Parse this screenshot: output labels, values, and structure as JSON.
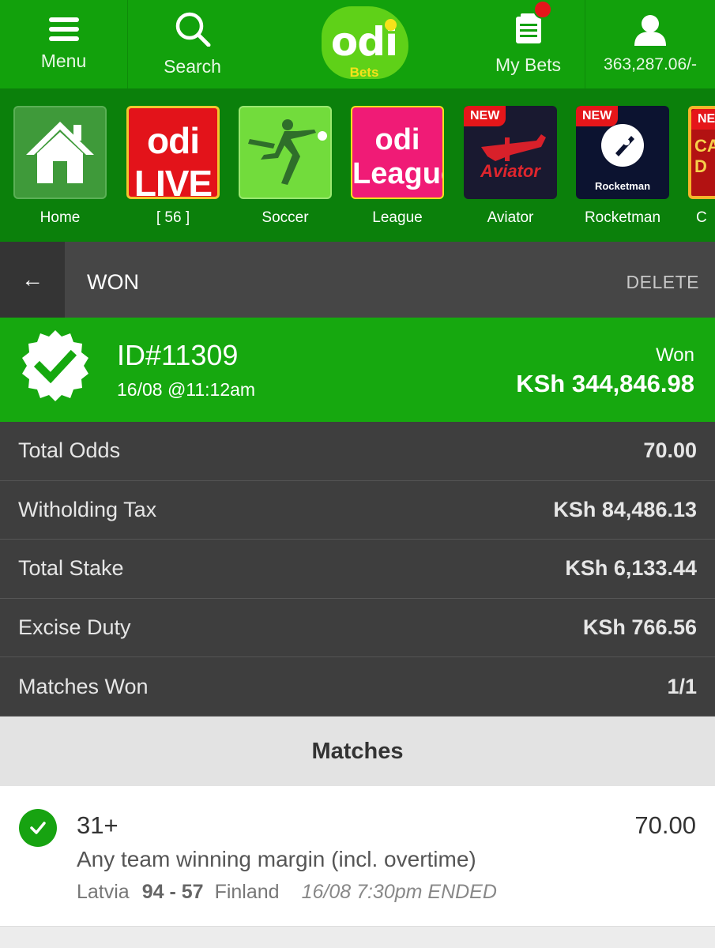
{
  "nav": {
    "menu_label": "Menu",
    "search_label": "Search",
    "logo_text": "odi",
    "logo_sub": "Bets",
    "mybets_label": "My Bets",
    "balance": "363,287.06/-"
  },
  "games": [
    {
      "label": "Home",
      "tile_text": "",
      "badge": ""
    },
    {
      "label": "[ 56 ]",
      "tile_text": "odi LIVE",
      "badge": ""
    },
    {
      "label": "Soccer",
      "tile_text": "",
      "badge": ""
    },
    {
      "label": "League",
      "tile_text": "odi League",
      "badge": ""
    },
    {
      "label": "Aviator",
      "tile_text": "Aviator",
      "badge": "NEW"
    },
    {
      "label": "Rocketman",
      "tile_text": "Rocketman",
      "badge": "NEW"
    },
    {
      "label": "C",
      "tile_text": "CA D",
      "badge": "NEW"
    }
  ],
  "header": {
    "back_icon": "←",
    "title": "WON",
    "delete_label": "DELETE"
  },
  "bet": {
    "id": "ID#11309",
    "date": "16/08 @11:12am",
    "status": "Won",
    "amount": "KSh 344,846.98"
  },
  "summary": [
    {
      "label": "Total Odds",
      "value": "70.00"
    },
    {
      "label": "Witholding Tax",
      "value": "KSh 84,486.13"
    },
    {
      "label": "Total Stake",
      "value": "KSh 6,133.44"
    },
    {
      "label": "Excise Duty",
      "value": "KSh 766.56"
    },
    {
      "label": "Matches Won",
      "value": "1/1"
    }
  ],
  "matches_title": "Matches",
  "match": {
    "pick": "31+",
    "odds": "70.00",
    "market": "Any team winning margin (incl. overtime)",
    "home": "Latvia",
    "score": "94 - 57",
    "away": "Finland",
    "status": "16/08 7:30pm ENDED"
  },
  "colors": {
    "brand_green": "#12a10c",
    "strip_green": "#0b800b",
    "dark_row": "#3e3e3e",
    "alert_red": "#e5161a"
  }
}
